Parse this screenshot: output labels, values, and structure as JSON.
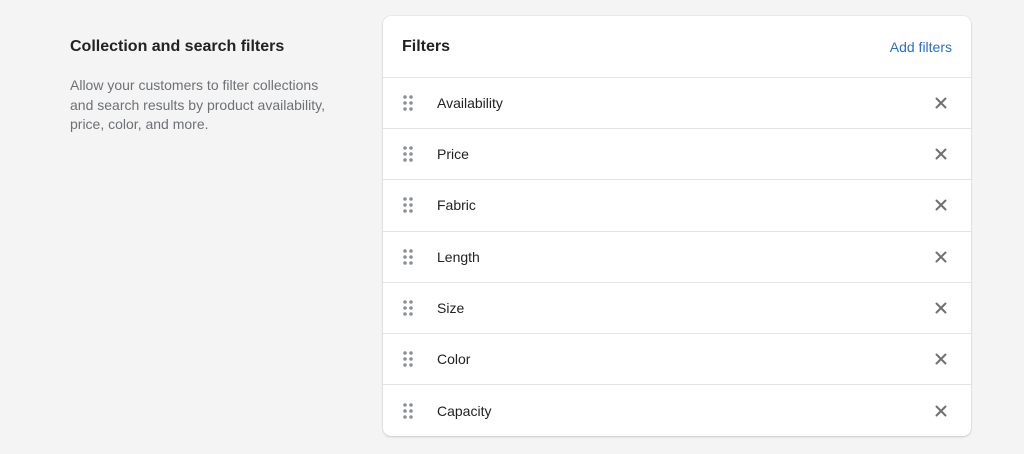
{
  "intro": {
    "title": "Collection and search filters",
    "description": "Allow your customers to filter collections and search results by product availability, price, color, and more."
  },
  "card": {
    "title": "Filters",
    "add_label": "Add filters",
    "accent_color": "#2c6ecb"
  },
  "filters": [
    {
      "label": "Availability",
      "drag_icon": "drag-handle-icon",
      "remove_icon": "close-icon"
    },
    {
      "label": "Price",
      "drag_icon": "drag-handle-icon",
      "remove_icon": "close-icon"
    },
    {
      "label": "Fabric",
      "drag_icon": "drag-handle-icon",
      "remove_icon": "close-icon"
    },
    {
      "label": "Length",
      "drag_icon": "drag-handle-icon",
      "remove_icon": "close-icon"
    },
    {
      "label": "Size",
      "drag_icon": "drag-handle-icon",
      "remove_icon": "close-icon"
    },
    {
      "label": "Color",
      "drag_icon": "drag-handle-icon",
      "remove_icon": "close-icon"
    },
    {
      "label": "Capacity",
      "drag_icon": "drag-handle-icon",
      "remove_icon": "close-icon"
    }
  ]
}
